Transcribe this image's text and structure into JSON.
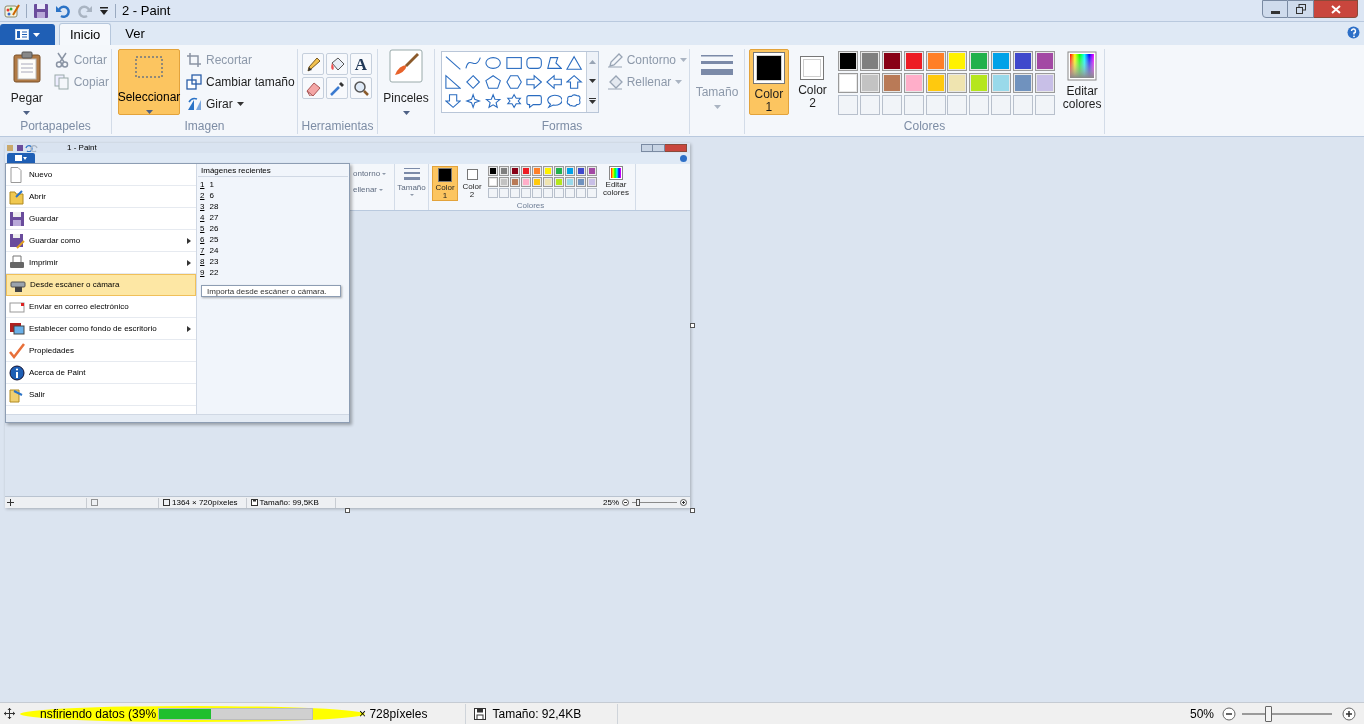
{
  "window": {
    "title": "2 - Paint"
  },
  "tabs": [
    {
      "label": "Inicio",
      "selected": true
    },
    {
      "label": "Ver",
      "selected": false
    }
  ],
  "clipboard": {
    "paste": "Pegar",
    "cut": {
      "label": "Cortar",
      "disabled": true
    },
    "copy": {
      "label": "Copiar",
      "disabled": true
    },
    "group_label": "Portapapeles"
  },
  "image": {
    "select": {
      "label": "Seleccionar",
      "selected": true
    },
    "crop": {
      "label": "Recortar",
      "disabled": true
    },
    "resize": {
      "label": "Cambiar tamaño",
      "disabled": false
    },
    "rotate": {
      "label": "Girar",
      "disabled": false
    },
    "group_label": "Imagen"
  },
  "tools": {
    "text_tool": "A",
    "group_label": "Herramientas"
  },
  "brushes": {
    "label": "Pinceles"
  },
  "shapes": {
    "outline": {
      "label": "Contorno",
      "disabled": true
    },
    "fill": {
      "label": "Rellenar",
      "disabled": true
    },
    "group_label": "Formas"
  },
  "size": {
    "label": "Tamaño",
    "disabled": true
  },
  "colors": {
    "color1": {
      "label": "Color 1",
      "selected": true
    },
    "color2": {
      "label": "Color 2",
      "selected": false
    },
    "palette": [
      {
        "color": "#000000"
      },
      {
        "color": "#7f7f7f"
      },
      {
        "color": "#880015"
      },
      {
        "color": "#ed1c24"
      },
      {
        "color": "#ff7f27"
      },
      {
        "color": "#fff200"
      },
      {
        "color": "#22b14c"
      },
      {
        "color": "#00a2e8"
      },
      {
        "color": "#3f48cc"
      },
      {
        "color": "#a349a4"
      },
      {
        "color": "#ffffff"
      },
      {
        "color": "#c3c3c3"
      },
      {
        "color": "#b97a57"
      },
      {
        "color": "#ffaec9"
      },
      {
        "color": "#ffc90e"
      },
      {
        "color": "#efe4b0"
      },
      {
        "color": "#b5e61d"
      },
      {
        "color": "#99d9ea"
      },
      {
        "color": "#7092be"
      },
      {
        "color": "#c8bfe7"
      }
    ],
    "edit": "Editar colores",
    "group_label": "Colores"
  },
  "canvas_image": {
    "title": "1 - Paint",
    "menu_items": [
      {
        "label": "Nuevo",
        "submenu": false,
        "selected": false
      },
      {
        "label": "Abrir",
        "submenu": false,
        "selected": false
      },
      {
        "label": "Guardar",
        "submenu": false,
        "selected": false
      },
      {
        "label": "Guardar como",
        "submenu": true,
        "selected": false
      },
      {
        "label": "Imprimir",
        "submenu": true,
        "selected": false
      },
      {
        "label": "Desde escáner o cámara",
        "submenu": false,
        "selected": true
      },
      {
        "label": "Enviar en correo electrónico",
        "submenu": false,
        "selected": false
      },
      {
        "label": "Establecer como fondo de escritorio",
        "submenu": true,
        "selected": false
      },
      {
        "label": "Propiedades",
        "submenu": false,
        "selected": false
      },
      {
        "label": "Acerca de Paint",
        "submenu": false,
        "selected": false
      },
      {
        "label": "Salir",
        "submenu": false,
        "selected": false
      }
    ],
    "recent_header": "Imágenes recientes",
    "recent": [
      {
        "key": "1",
        "name": "1"
      },
      {
        "key": "2",
        "name": "6"
      },
      {
        "key": "3",
        "name": "28"
      },
      {
        "key": "4",
        "name": "27"
      },
      {
        "key": "5",
        "name": "26"
      },
      {
        "key": "6",
        "name": "25"
      },
      {
        "key": "7",
        "name": "24"
      },
      {
        "key": "8",
        "name": "23"
      },
      {
        "key": "9",
        "name": "22"
      }
    ],
    "tooltip": "Importa desde escáner o cámara.",
    "outline": "ontorno",
    "fill": "ellenar",
    "size": "Tamaño",
    "color1": "Color 1",
    "color2": "Color 2",
    "palette": [
      {
        "color": "#000000"
      },
      {
        "color": "#7f7f7f"
      },
      {
        "color": "#880015"
      },
      {
        "color": "#ed1c24"
      },
      {
        "color": "#ff7f27"
      },
      {
        "color": "#fff200"
      },
      {
        "color": "#22b14c"
      },
      {
        "color": "#00a2e8"
      },
      {
        "color": "#3f48cc"
      },
      {
        "color": "#a349a4"
      },
      {
        "color": "#ffffff"
      },
      {
        "color": "#c3c3c3"
      },
      {
        "color": "#b97a57"
      },
      {
        "color": "#ffaec9"
      },
      {
        "color": "#ffc90e"
      },
      {
        "color": "#efe4b0"
      },
      {
        "color": "#b5e61d"
      },
      {
        "color": "#99d9ea"
      },
      {
        "color": "#7092be"
      },
      {
        "color": "#c8bfe7"
      }
    ],
    "edit": "Editar colores",
    "colors_label": "Colores",
    "status_dimensions": "1364 × 720píxeles",
    "status_size": "Tamaño: 99,5KB",
    "zoom": "25%",
    "zoom_slider": {
      "level": 0.1
    }
  },
  "status_bar": {
    "progress_text": "nsfiriendo datos (39%",
    "progress": {
      "level": 0.34
    },
    "dimensions": "× 728píxeles",
    "size": "Tamaño: 92,4KB",
    "zoom": "50%",
    "zoom_slider": {
      "level": 0.28
    }
  }
}
